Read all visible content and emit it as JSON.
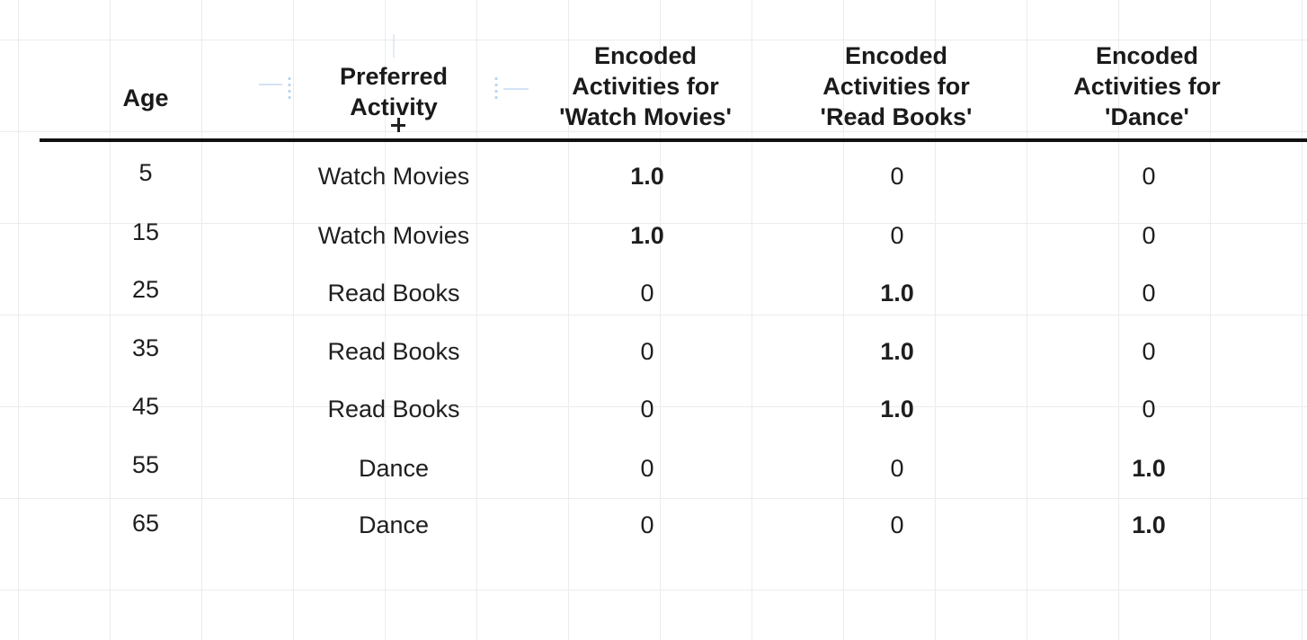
{
  "table": {
    "headers": {
      "age": "Age",
      "preferred_activity": "Preferred\nActivity",
      "encoded_watch_movies": "Encoded\nActivities for\n'Watch Movies'",
      "encoded_read_books": "Encoded\nActivities for\n'Read Books'",
      "encoded_dance": "Encoded\nActivities for\n'Dance'"
    },
    "rows": [
      {
        "age": "5",
        "activity": "Watch Movies",
        "watch_movies": "1.0",
        "read_books": "0",
        "dance": "0"
      },
      {
        "age": "15",
        "activity": "Watch Movies",
        "watch_movies": "1.0",
        "read_books": "0",
        "dance": "0"
      },
      {
        "age": "25",
        "activity": "Read Books",
        "watch_movies": "0",
        "read_books": "1.0",
        "dance": "0"
      },
      {
        "age": "35",
        "activity": "Read Books",
        "watch_movies": "0",
        "read_books": "1.0",
        "dance": "0"
      },
      {
        "age": "45",
        "activity": "Read Books",
        "watch_movies": "0",
        "read_books": "1.0",
        "dance": "0"
      },
      {
        "age": "55",
        "activity": "Dance",
        "watch_movies": "0",
        "read_books": "0",
        "dance": "1.0"
      },
      {
        "age": "65",
        "activity": "Dance",
        "watch_movies": "0",
        "read_books": "0",
        "dance": "1.0"
      }
    ]
  },
  "icons": {
    "cursor": "move-cursor-icon",
    "selection_handles": "resize-handle-icon"
  },
  "colors": {
    "text": "#1c1c1c",
    "rule": "#111111",
    "grid": "#ececec",
    "handle": "#a9c7ea"
  }
}
